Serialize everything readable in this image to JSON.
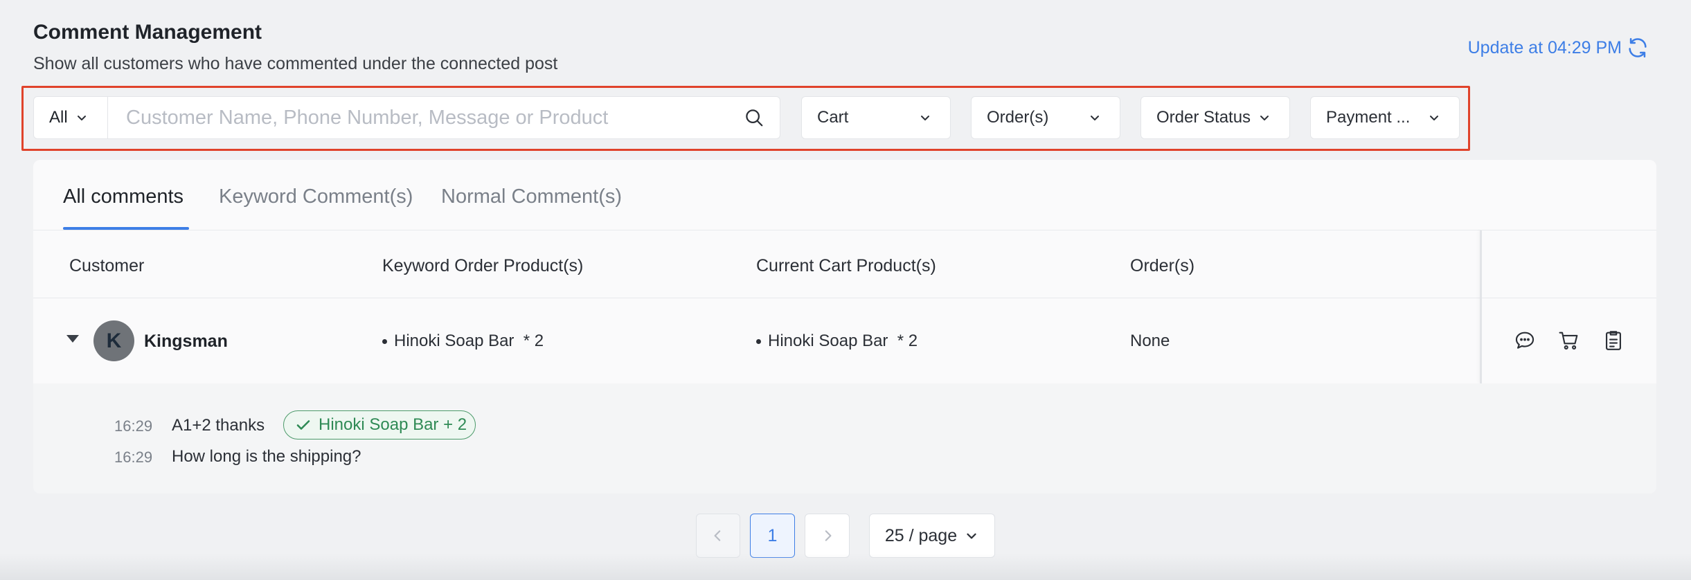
{
  "header": {
    "title": "Comment Management",
    "subtitle": "Show all customers who have commented under the connected post",
    "update_label": "Update at 04:29 PM"
  },
  "filters": {
    "scope_value": "All",
    "search_placeholder": "Customer Name, Phone Number, Message or Product",
    "dropdowns": [
      {
        "label": "Cart"
      },
      {
        "label": "Order(s)"
      },
      {
        "label": "Order Status"
      },
      {
        "label": "Payment ..."
      }
    ]
  },
  "tabs": [
    {
      "label": "All comments",
      "active": true
    },
    {
      "label": "Keyword Comment(s)",
      "active": false
    },
    {
      "label": "Normal Comment(s)",
      "active": false
    }
  ],
  "table": {
    "columns": [
      "Customer",
      "Keyword Order Product(s)",
      "Current Cart Product(s)",
      "Order(s)"
    ],
    "rows": [
      {
        "avatar_initial": "K",
        "customer": "Kingsman",
        "keyword_products": [
          "Hinoki Soap Bar  * 2"
        ],
        "cart_products": [
          "Hinoki Soap Bar  * 2"
        ],
        "orders": "None",
        "comments": [
          {
            "time": "16:29",
            "text": "A1+2 thanks",
            "tag": "Hinoki Soap Bar + 2"
          },
          {
            "time": "16:29",
            "text": "How long is the shipping?"
          }
        ]
      }
    ]
  },
  "pagination": {
    "current_page": "1",
    "page_size": "25 / page"
  },
  "colors": {
    "accent": "#3d7ee6",
    "highlight_outline": "#e0432b",
    "tag_green": "#2f8a55"
  }
}
